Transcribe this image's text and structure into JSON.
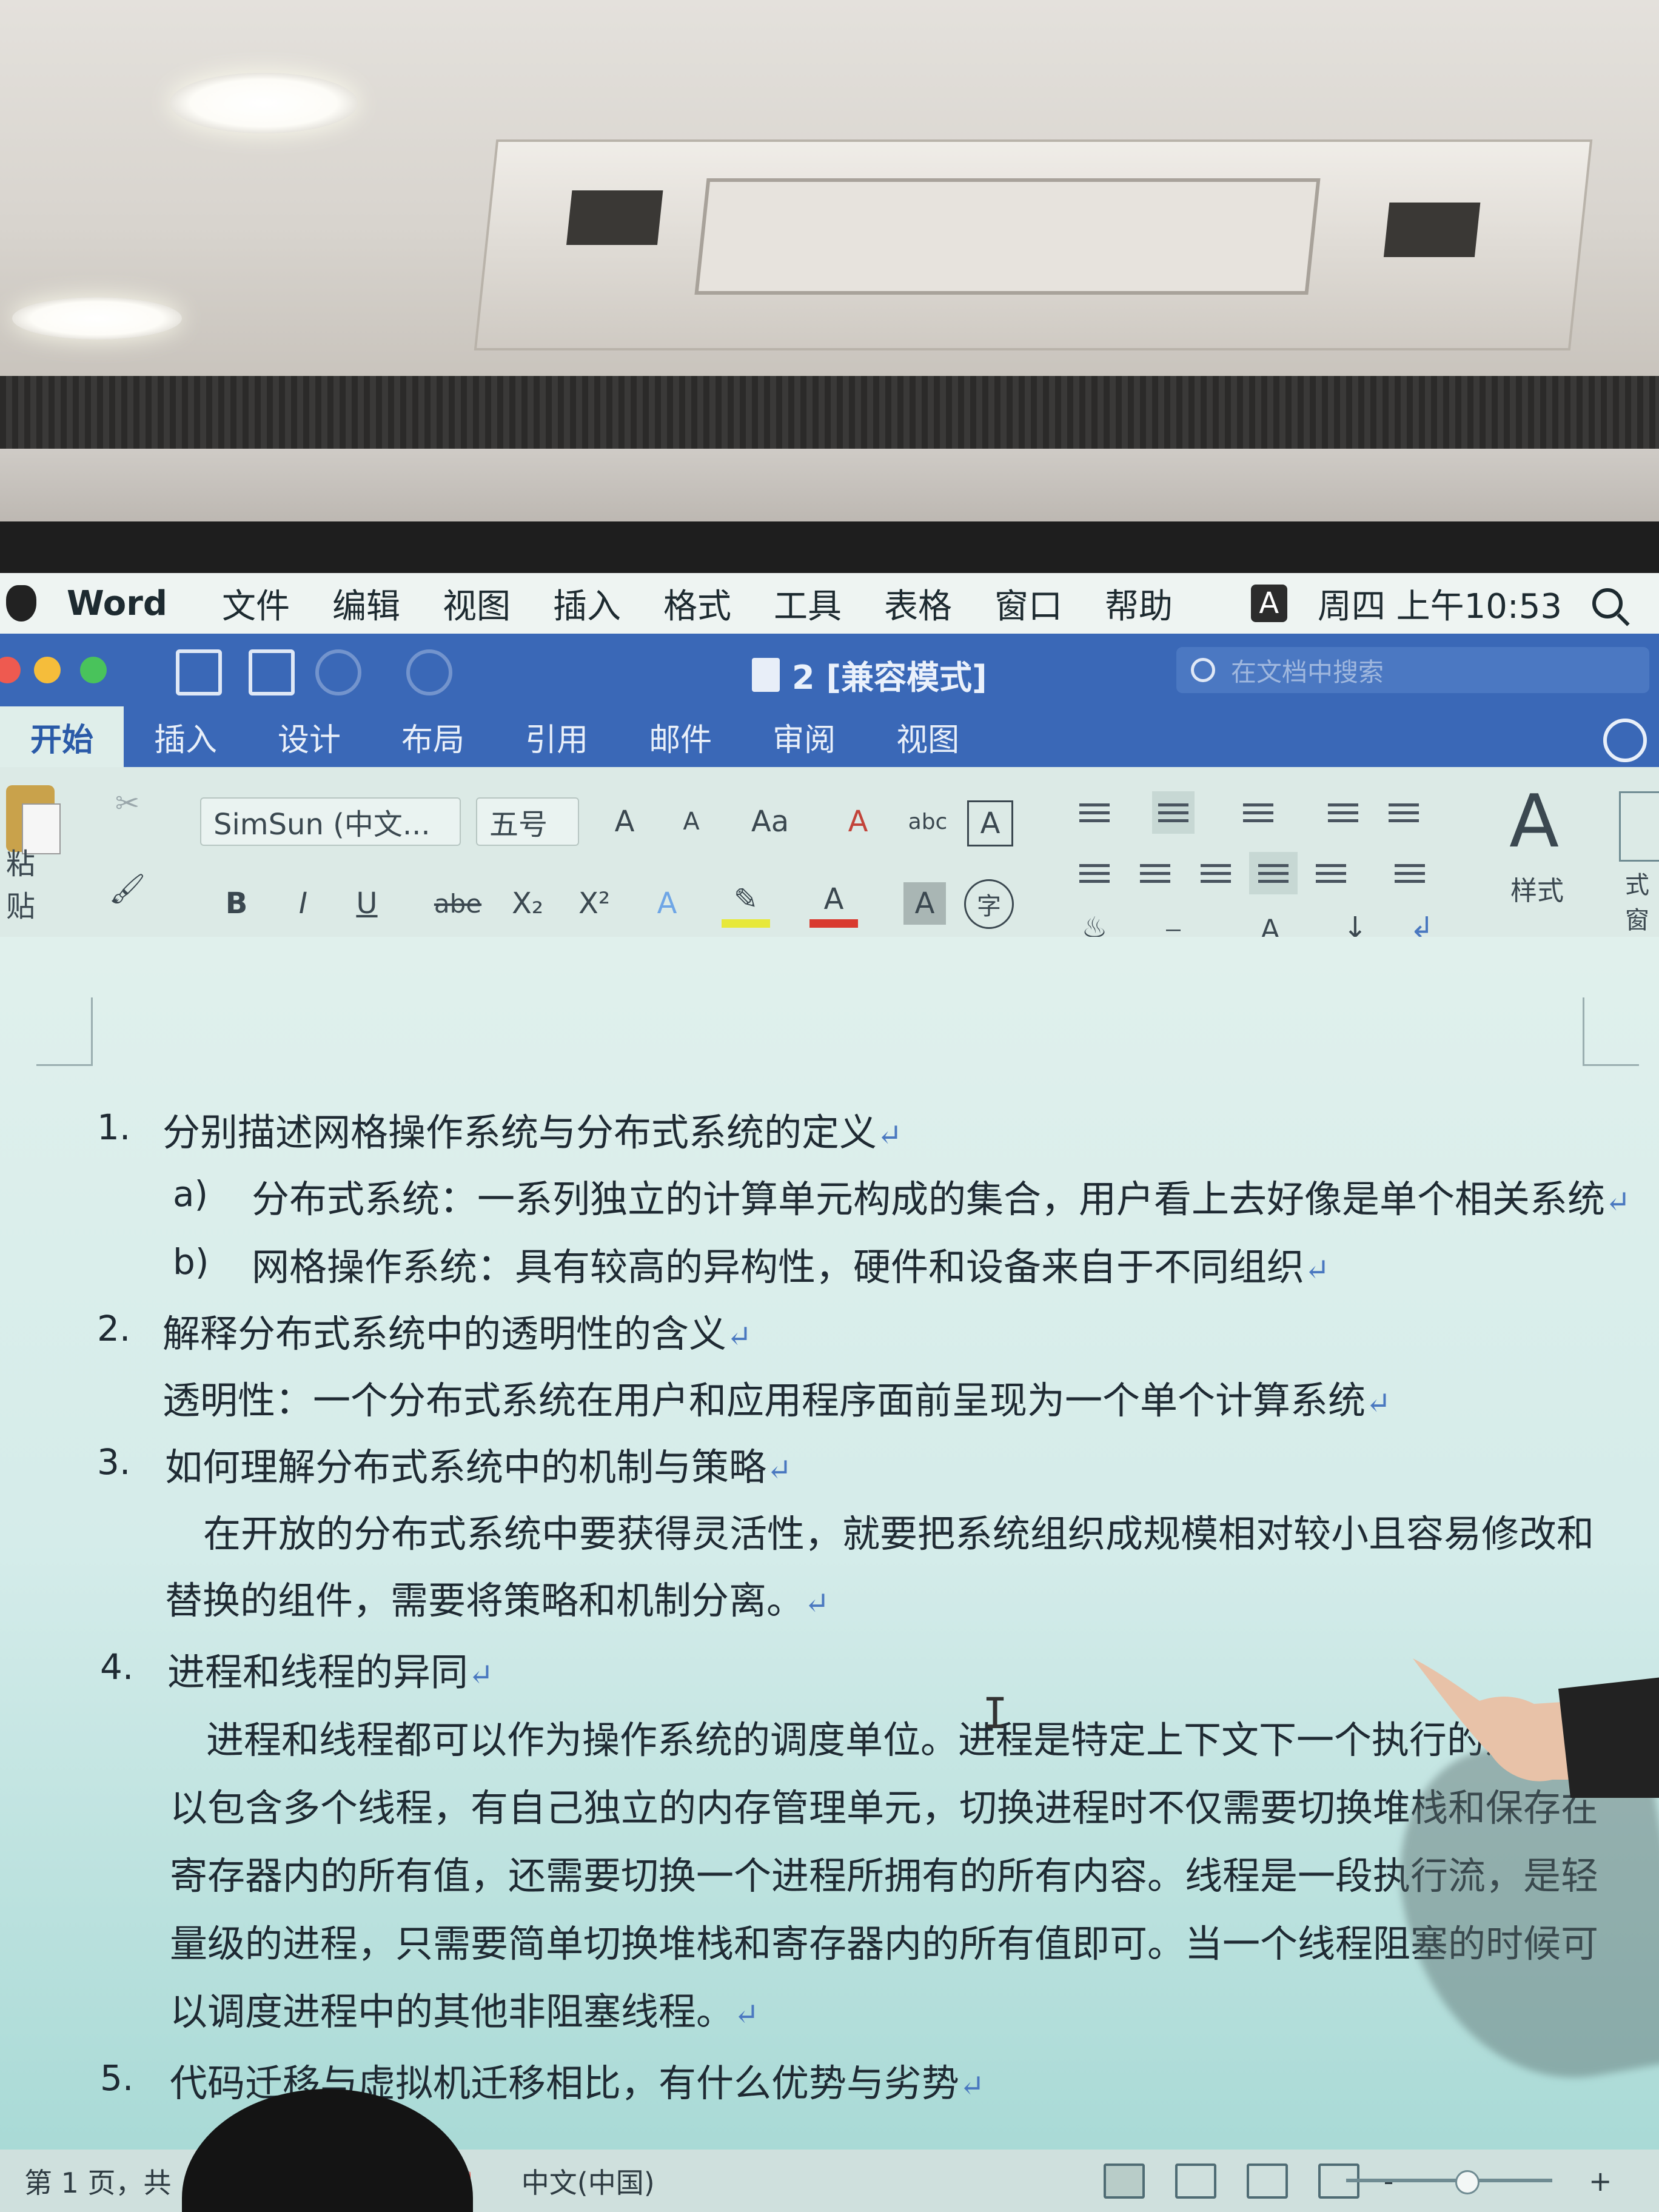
{
  "menubar": {
    "app": "Word",
    "items": [
      "文件",
      "编辑",
      "视图",
      "插入",
      "格式",
      "工具",
      "表格",
      "窗口",
      "帮助"
    ],
    "input_badge": "A",
    "clock": "周四 上午10:53"
  },
  "window": {
    "title": "2 [兼容模式]",
    "search_placeholder": "在文档中搜索"
  },
  "ribbon_tabs": [
    "开始",
    "插入",
    "设计",
    "布局",
    "引用",
    "邮件",
    "审阅",
    "视图"
  ],
  "ribbon": {
    "paste_label": "粘贴",
    "font_name": "SimSun (中文...",
    "font_size": "五号",
    "styles_label": "样式",
    "styles_pane_label": "样式窗格",
    "grow_font": "A",
    "shrink_font": "A",
    "change_case": "Aa",
    "clear_format": "A",
    "phonetic": "abc",
    "char_border": "A",
    "bold": "B",
    "italic": "I",
    "underline": "U",
    "strikethrough": "abe",
    "subscript": "X₂",
    "superscript": "X²",
    "text_effects": "A",
    "font_color": "A",
    "char_shading": "A",
    "enclose_char": "字"
  },
  "document": {
    "paragraph_mark": "↵",
    "items": [
      {
        "num": "1.",
        "text": "分别描述网格操作系统与分布式系统的定义"
      },
      {
        "num": "a)",
        "text": "分布式系统：一系列独立的计算单元构成的集合，用户看上去好像是单个相关系统"
      },
      {
        "num": "b)",
        "text": "网格操作系统：具有较高的异构性，硬件和设备来自于不同组织"
      },
      {
        "num": "2.",
        "text": "解释分布式系统中的透明性的含义"
      },
      {
        "num": "",
        "text": "透明性：一个分布式系统在用户和应用程序面前呈现为一个单个计算系统"
      },
      {
        "num": "3.",
        "text": "如何理解分布式系统中的机制与策略"
      },
      {
        "num": "",
        "text": "在开放的分布式系统中要获得灵活性，就要把系统组织成规模相对较小且容易修改和"
      },
      {
        "num": "",
        "text": "替换的组件，需要将策略和机制分离。"
      },
      {
        "num": "4.",
        "text": "进程和线程的异同"
      },
      {
        "num": "",
        "text": "进程和线程都可以作为操作系统的调度单位。进程是特定上下文下一个执行的流，可"
      },
      {
        "num": "",
        "text": "以包含多个线程，有自己独立的内存管理单元，切换进程时不仅需要切换堆栈和保存在"
      },
      {
        "num": "",
        "text": "寄存器内的所有值，还需要切换一个进程所拥有的所有内容。线程是一段执行流，是轻"
      },
      {
        "num": "",
        "text": "量级的进程，只需要简单切换堆栈和寄存器内的所有值即可。当一个线程阻塞的时候可"
      },
      {
        "num": "",
        "text": "以调度进程中的其他非阻塞线程。"
      },
      {
        "num": "5.",
        "text": "代码迁移与虚拟机迁移相比，有什么优势与劣势"
      }
    ]
  },
  "statusbar": {
    "page": "第 1 页，共",
    "language": "中文(中国)",
    "zoom_minus": "-",
    "zoom_plus": "+"
  }
}
